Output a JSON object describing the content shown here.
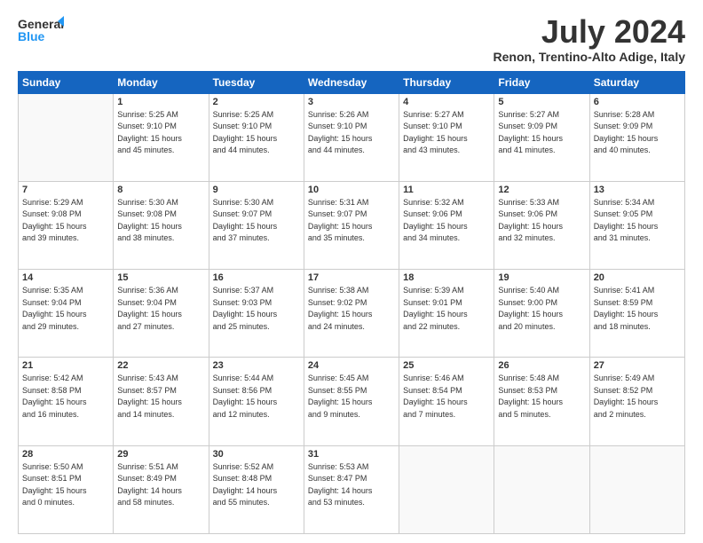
{
  "header": {
    "logo_general": "General",
    "logo_blue": "Blue",
    "month_title": "July 2024",
    "location": "Renon, Trentino-Alto Adige, Italy"
  },
  "weekdays": [
    "Sunday",
    "Monday",
    "Tuesday",
    "Wednesday",
    "Thursday",
    "Friday",
    "Saturday"
  ],
  "weeks": [
    [
      {
        "day": "",
        "info": ""
      },
      {
        "day": "1",
        "info": "Sunrise: 5:25 AM\nSunset: 9:10 PM\nDaylight: 15 hours\nand 45 minutes."
      },
      {
        "day": "2",
        "info": "Sunrise: 5:25 AM\nSunset: 9:10 PM\nDaylight: 15 hours\nand 44 minutes."
      },
      {
        "day": "3",
        "info": "Sunrise: 5:26 AM\nSunset: 9:10 PM\nDaylight: 15 hours\nand 44 minutes."
      },
      {
        "day": "4",
        "info": "Sunrise: 5:27 AM\nSunset: 9:10 PM\nDaylight: 15 hours\nand 43 minutes."
      },
      {
        "day": "5",
        "info": "Sunrise: 5:27 AM\nSunset: 9:09 PM\nDaylight: 15 hours\nand 41 minutes."
      },
      {
        "day": "6",
        "info": "Sunrise: 5:28 AM\nSunset: 9:09 PM\nDaylight: 15 hours\nand 40 minutes."
      }
    ],
    [
      {
        "day": "7",
        "info": "Sunrise: 5:29 AM\nSunset: 9:08 PM\nDaylight: 15 hours\nand 39 minutes."
      },
      {
        "day": "8",
        "info": "Sunrise: 5:30 AM\nSunset: 9:08 PM\nDaylight: 15 hours\nand 38 minutes."
      },
      {
        "day": "9",
        "info": "Sunrise: 5:30 AM\nSunset: 9:07 PM\nDaylight: 15 hours\nand 37 minutes."
      },
      {
        "day": "10",
        "info": "Sunrise: 5:31 AM\nSunset: 9:07 PM\nDaylight: 15 hours\nand 35 minutes."
      },
      {
        "day": "11",
        "info": "Sunrise: 5:32 AM\nSunset: 9:06 PM\nDaylight: 15 hours\nand 34 minutes."
      },
      {
        "day": "12",
        "info": "Sunrise: 5:33 AM\nSunset: 9:06 PM\nDaylight: 15 hours\nand 32 minutes."
      },
      {
        "day": "13",
        "info": "Sunrise: 5:34 AM\nSunset: 9:05 PM\nDaylight: 15 hours\nand 31 minutes."
      }
    ],
    [
      {
        "day": "14",
        "info": "Sunrise: 5:35 AM\nSunset: 9:04 PM\nDaylight: 15 hours\nand 29 minutes."
      },
      {
        "day": "15",
        "info": "Sunrise: 5:36 AM\nSunset: 9:04 PM\nDaylight: 15 hours\nand 27 minutes."
      },
      {
        "day": "16",
        "info": "Sunrise: 5:37 AM\nSunset: 9:03 PM\nDaylight: 15 hours\nand 25 minutes."
      },
      {
        "day": "17",
        "info": "Sunrise: 5:38 AM\nSunset: 9:02 PM\nDaylight: 15 hours\nand 24 minutes."
      },
      {
        "day": "18",
        "info": "Sunrise: 5:39 AM\nSunset: 9:01 PM\nDaylight: 15 hours\nand 22 minutes."
      },
      {
        "day": "19",
        "info": "Sunrise: 5:40 AM\nSunset: 9:00 PM\nDaylight: 15 hours\nand 20 minutes."
      },
      {
        "day": "20",
        "info": "Sunrise: 5:41 AM\nSunset: 8:59 PM\nDaylight: 15 hours\nand 18 minutes."
      }
    ],
    [
      {
        "day": "21",
        "info": "Sunrise: 5:42 AM\nSunset: 8:58 PM\nDaylight: 15 hours\nand 16 minutes."
      },
      {
        "day": "22",
        "info": "Sunrise: 5:43 AM\nSunset: 8:57 PM\nDaylight: 15 hours\nand 14 minutes."
      },
      {
        "day": "23",
        "info": "Sunrise: 5:44 AM\nSunset: 8:56 PM\nDaylight: 15 hours\nand 12 minutes."
      },
      {
        "day": "24",
        "info": "Sunrise: 5:45 AM\nSunset: 8:55 PM\nDaylight: 15 hours\nand 9 minutes."
      },
      {
        "day": "25",
        "info": "Sunrise: 5:46 AM\nSunset: 8:54 PM\nDaylight: 15 hours\nand 7 minutes."
      },
      {
        "day": "26",
        "info": "Sunrise: 5:48 AM\nSunset: 8:53 PM\nDaylight: 15 hours\nand 5 minutes."
      },
      {
        "day": "27",
        "info": "Sunrise: 5:49 AM\nSunset: 8:52 PM\nDaylight: 15 hours\nand 2 minutes."
      }
    ],
    [
      {
        "day": "28",
        "info": "Sunrise: 5:50 AM\nSunset: 8:51 PM\nDaylight: 15 hours\nand 0 minutes."
      },
      {
        "day": "29",
        "info": "Sunrise: 5:51 AM\nSunset: 8:49 PM\nDaylight: 14 hours\nand 58 minutes."
      },
      {
        "day": "30",
        "info": "Sunrise: 5:52 AM\nSunset: 8:48 PM\nDaylight: 14 hours\nand 55 minutes."
      },
      {
        "day": "31",
        "info": "Sunrise: 5:53 AM\nSunset: 8:47 PM\nDaylight: 14 hours\nand 53 minutes."
      },
      {
        "day": "",
        "info": ""
      },
      {
        "day": "",
        "info": ""
      },
      {
        "day": "",
        "info": ""
      }
    ]
  ]
}
